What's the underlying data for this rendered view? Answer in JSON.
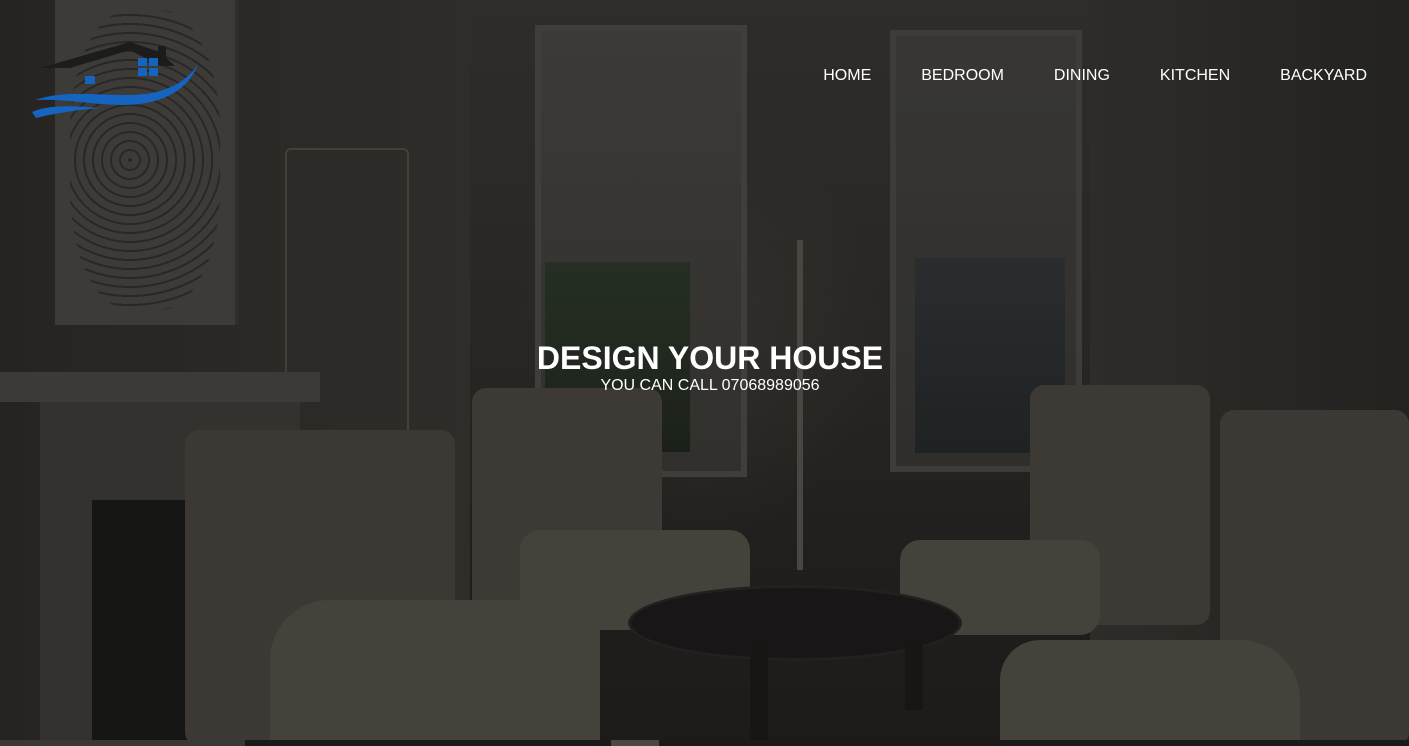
{
  "nav": {
    "items": [
      {
        "label": "HOME"
      },
      {
        "label": "BEDROOM"
      },
      {
        "label": "DINING"
      },
      {
        "label": "KITCHEN"
      },
      {
        "label": "BACKYARD"
      }
    ]
  },
  "hero": {
    "title": "DESIGN YOUR HOUSE",
    "subtitle": "YOU CAN CALL 07068989056",
    "background_image": "dimmed-living-room-photo"
  },
  "logo": {
    "icon": "house-wave-logo",
    "roof_color": "#1c1c1c",
    "accent_color": "#1565c0"
  },
  "colors": {
    "text": "#ffffff"
  }
}
